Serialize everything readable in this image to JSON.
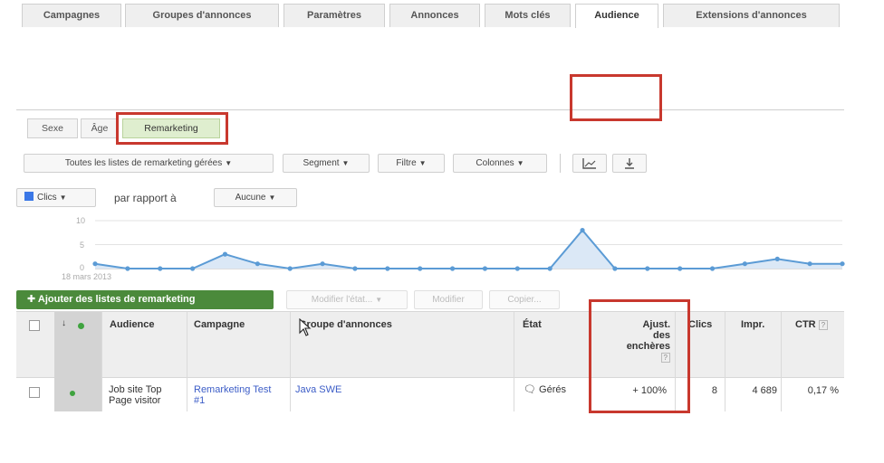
{
  "tabs": [
    {
      "label": "Campagnes",
      "active": false
    },
    {
      "label": "Groupes d'annonces",
      "active": false
    },
    {
      "label": "Paramètres",
      "active": false
    },
    {
      "label": "Annonces",
      "active": false
    },
    {
      "label": "Mots clés",
      "active": false
    },
    {
      "label": "Audience",
      "active": true
    },
    {
      "label": "Extensions d'annonces",
      "active": false
    }
  ],
  "subtabs": [
    {
      "label": "Sexe",
      "selected": false
    },
    {
      "label": "Âge",
      "selected": false
    },
    {
      "label": "Remarketing",
      "selected": true
    }
  ],
  "toolbar": {
    "lists_label": "Toutes les listes de remarketing gérées",
    "segment_label": "Segment",
    "filter_label": "Filtre",
    "columns_label": "Colonnes",
    "chart_icon": "line-chart-icon",
    "download_icon": "download-icon"
  },
  "metric_selector": {
    "metric_label": "Clics",
    "metric_color": "#3b78e7",
    "compare_text": "par rapport à",
    "compare_value": "Aucune"
  },
  "chart_data": {
    "type": "area",
    "series": [
      {
        "name": "Clics",
        "color": "#5b9bd5",
        "values": [
          1,
          0,
          0,
          0,
          3,
          1,
          0,
          1,
          0,
          0,
          0,
          0,
          0,
          0,
          0,
          8,
          0,
          0,
          0,
          0,
          1,
          2,
          1,
          1
        ]
      }
    ],
    "y_ticks": [
      "10",
      "5",
      "0"
    ],
    "ylim": [
      0,
      10
    ],
    "x_start_label": "18 mars 2013",
    "grid": true
  },
  "actions": {
    "add_lists_label": "Ajouter des listes de remarketing",
    "modify_state_label": "Modifier l'état...",
    "modify_label": "Modifier",
    "copy_label": "Copier..."
  },
  "table": {
    "headers": {
      "audience": "Audience",
      "campaign": "Campagne",
      "adgroup": "Groupe d'annonces",
      "state": "État",
      "bid_line1": "Ajust.",
      "bid_line2": "des",
      "bid_line3": "enchères",
      "help": "?",
      "clicks": "Clics",
      "impr": "Impr.",
      "ctr": "CTR"
    },
    "row": {
      "audience": "Job site Top Page visitor",
      "campaign": "Remarketing Test #1",
      "adgroup": "Java SWE",
      "state": "Gérés",
      "bid": "+ 100%",
      "clicks": "8",
      "impr": "4 689",
      "ctr": "0,17 %"
    }
  }
}
